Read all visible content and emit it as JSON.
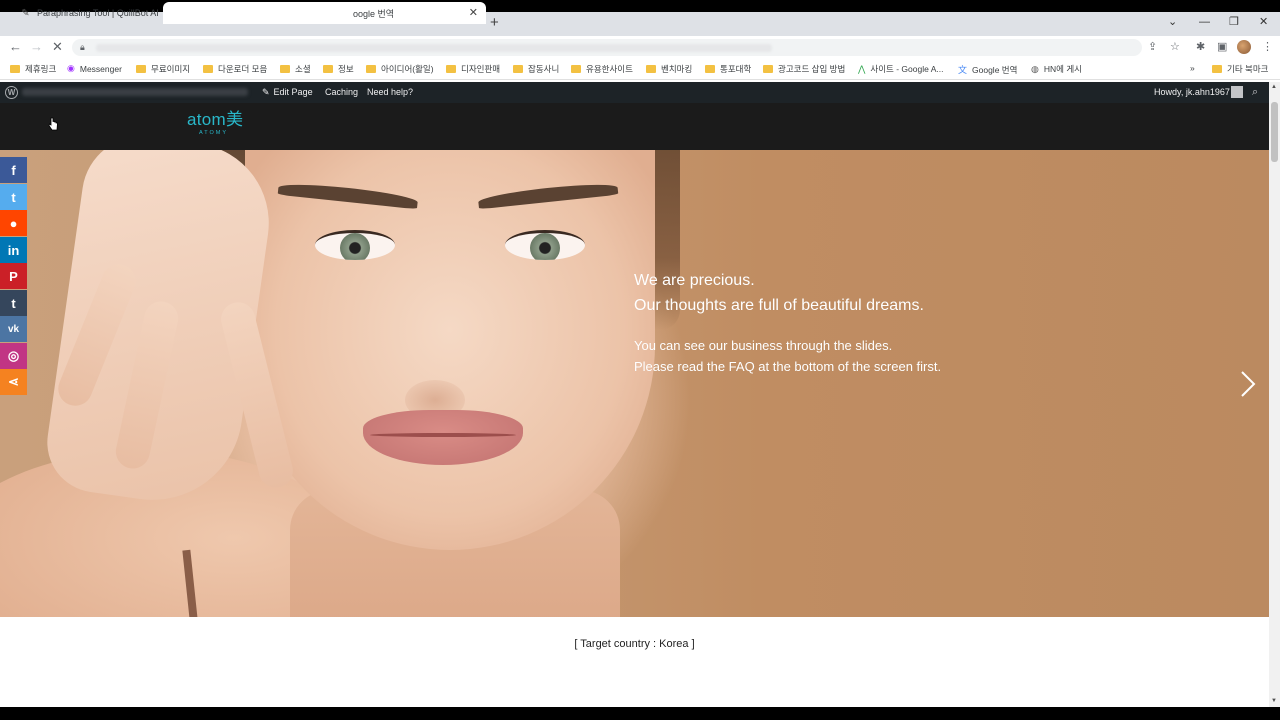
{
  "browser": {
    "tabs": [
      {
        "title": "Paraphrasing Tool | QuillBot AI",
        "active": false
      },
      {
        "title": "oogle 번역",
        "active": true
      }
    ],
    "bookmarks": [
      "제휴링크",
      "Messenger",
      "무료이미지",
      "다운로더 모음",
      "소셜",
      "정보",
      "아이디어(활일)",
      "디자인판매",
      "잡동사니",
      "유용한사이트",
      "벤치마킹",
      "통포대학",
      "광고코드 삽입 방법",
      "사이트 - Google A...",
      "Google 번역",
      "HN에 게시"
    ],
    "bookmarks_more": "»",
    "other_bookmarks": "기타 북마크"
  },
  "wp_admin": {
    "edit_page": "Edit Page",
    "caching": "Caching",
    "need_help": "Need help?",
    "howdy": "Howdy, jk.ahn1967"
  },
  "site": {
    "logo": "atom美",
    "logo_sub": "ATOMY"
  },
  "hero": {
    "line1": "We are precious.",
    "line2": "Our thoughts are full of beautiful dreams.",
    "line3": "You can see our business through the slides.",
    "line4": "Please read the FAQ at the bottom of the screen first."
  },
  "content": {
    "target_country": "[ Target country : Korea ]"
  },
  "social_colors": {
    "facebook": "#3b5998",
    "twitter": "#55acee",
    "reddit": "#ff4500",
    "linkedin": "#0077b5",
    "pinterest": "#cb2027",
    "tumblr": "#35465c",
    "vk": "#4c75a3",
    "instagram": "#c13584",
    "share": "#f58220"
  },
  "icons": [
    "facebook-icon",
    "twitter-icon",
    "reddit-icon",
    "linkedin-icon",
    "pinterest-icon",
    "tumblr-icon",
    "vk-icon",
    "instagram-icon",
    "share-icon"
  ]
}
